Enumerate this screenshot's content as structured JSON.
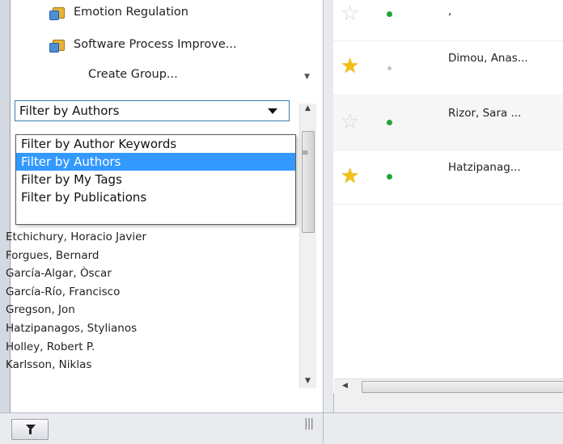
{
  "groups": {
    "items": [
      {
        "label": "Emotion Regulation",
        "icon": "folder-group-icon"
      },
      {
        "label": "Software Process Improve...",
        "icon": "folder-group-icon"
      }
    ],
    "create_group_label": "Create Group..."
  },
  "filter": {
    "selected_value": "Filter by Authors",
    "options": [
      "Filter by Author Keywords",
      "Filter by Authors",
      "Filter by My Tags",
      "Filter by Publications"
    ],
    "highlighted_index": 1,
    "authors": [
      "Etchichury, Horacio Javier",
      "Forgues, Bernard",
      "García-Algar, Òscar",
      "García-Río, Francisco",
      "Gregson, Jon",
      "Hatzipanagos, Stylianos",
      "Holley, Robert P.",
      "Karlsson, Niklas"
    ]
  },
  "documents": [
    {
      "starred": false,
      "read_status": "unread",
      "authors": ","
    },
    {
      "starred": true,
      "read_status": "read",
      "authors": "Dimou, Anas..."
    },
    {
      "starred": false,
      "read_status": "unread",
      "authors": "Rizor, Sara ..."
    },
    {
      "starred": true,
      "read_status": "unread",
      "authors": "Hatzipanag..."
    }
  ],
  "colors": {
    "selection": "#3399ff",
    "star": "#f2c018",
    "unread_dot": "#22a633"
  }
}
